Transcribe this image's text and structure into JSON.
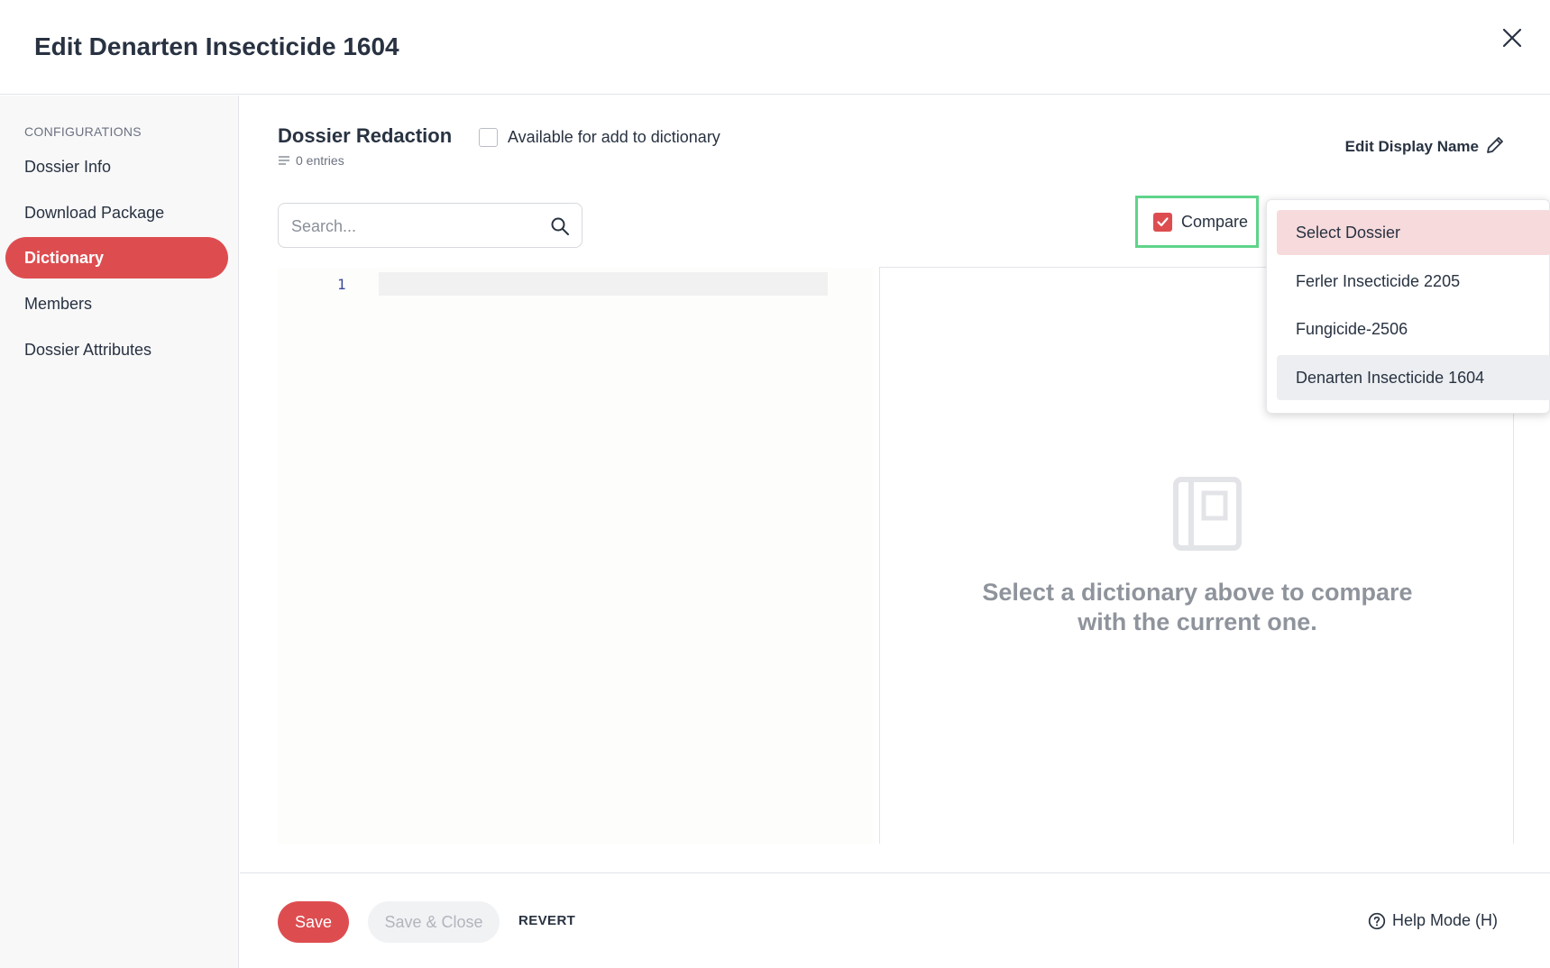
{
  "header": {
    "title": "Edit Denarten Insecticide 1604",
    "close_icon": "close-icon"
  },
  "sidebar": {
    "section_label": "CONFIGURATIONS",
    "items": [
      {
        "label": "Dossier Info",
        "active": false
      },
      {
        "label": "Download Package",
        "active": false
      },
      {
        "label": "Dictionary",
        "active": true
      },
      {
        "label": "Members",
        "active": false
      },
      {
        "label": "Dossier Attributes",
        "active": false
      }
    ]
  },
  "main": {
    "dictionary_title": "Dossier Redaction",
    "entries_text": "0 entries",
    "available_label": "Available for add to dictionary",
    "available_checked": false,
    "edit_display_name": "Edit Display Name",
    "search": {
      "placeholder": "Search...",
      "value": ""
    },
    "compare": {
      "label": "Compare",
      "checked": true
    },
    "editor": {
      "line_numbers": [
        "1"
      ]
    },
    "empty_state": {
      "icon": "dictionary-book-icon",
      "text": "Select a dictionary above to compare with the current one."
    }
  },
  "dropdown": {
    "options": [
      {
        "label": "Select Dossier",
        "state": "highlighted"
      },
      {
        "label": "Ferler Insecticide 2205",
        "state": ""
      },
      {
        "label": "Fungicide-2506",
        "state": ""
      },
      {
        "label": "Denarten Insecticide 1604",
        "state": "selected"
      }
    ]
  },
  "footer": {
    "save": "Save",
    "save_close": "Save & Close",
    "revert": "REVERT",
    "help": "Help Mode (H)"
  },
  "colors": {
    "accent": "#dd4d50",
    "highlight_frame": "#5fd48a",
    "text": "#283241"
  }
}
